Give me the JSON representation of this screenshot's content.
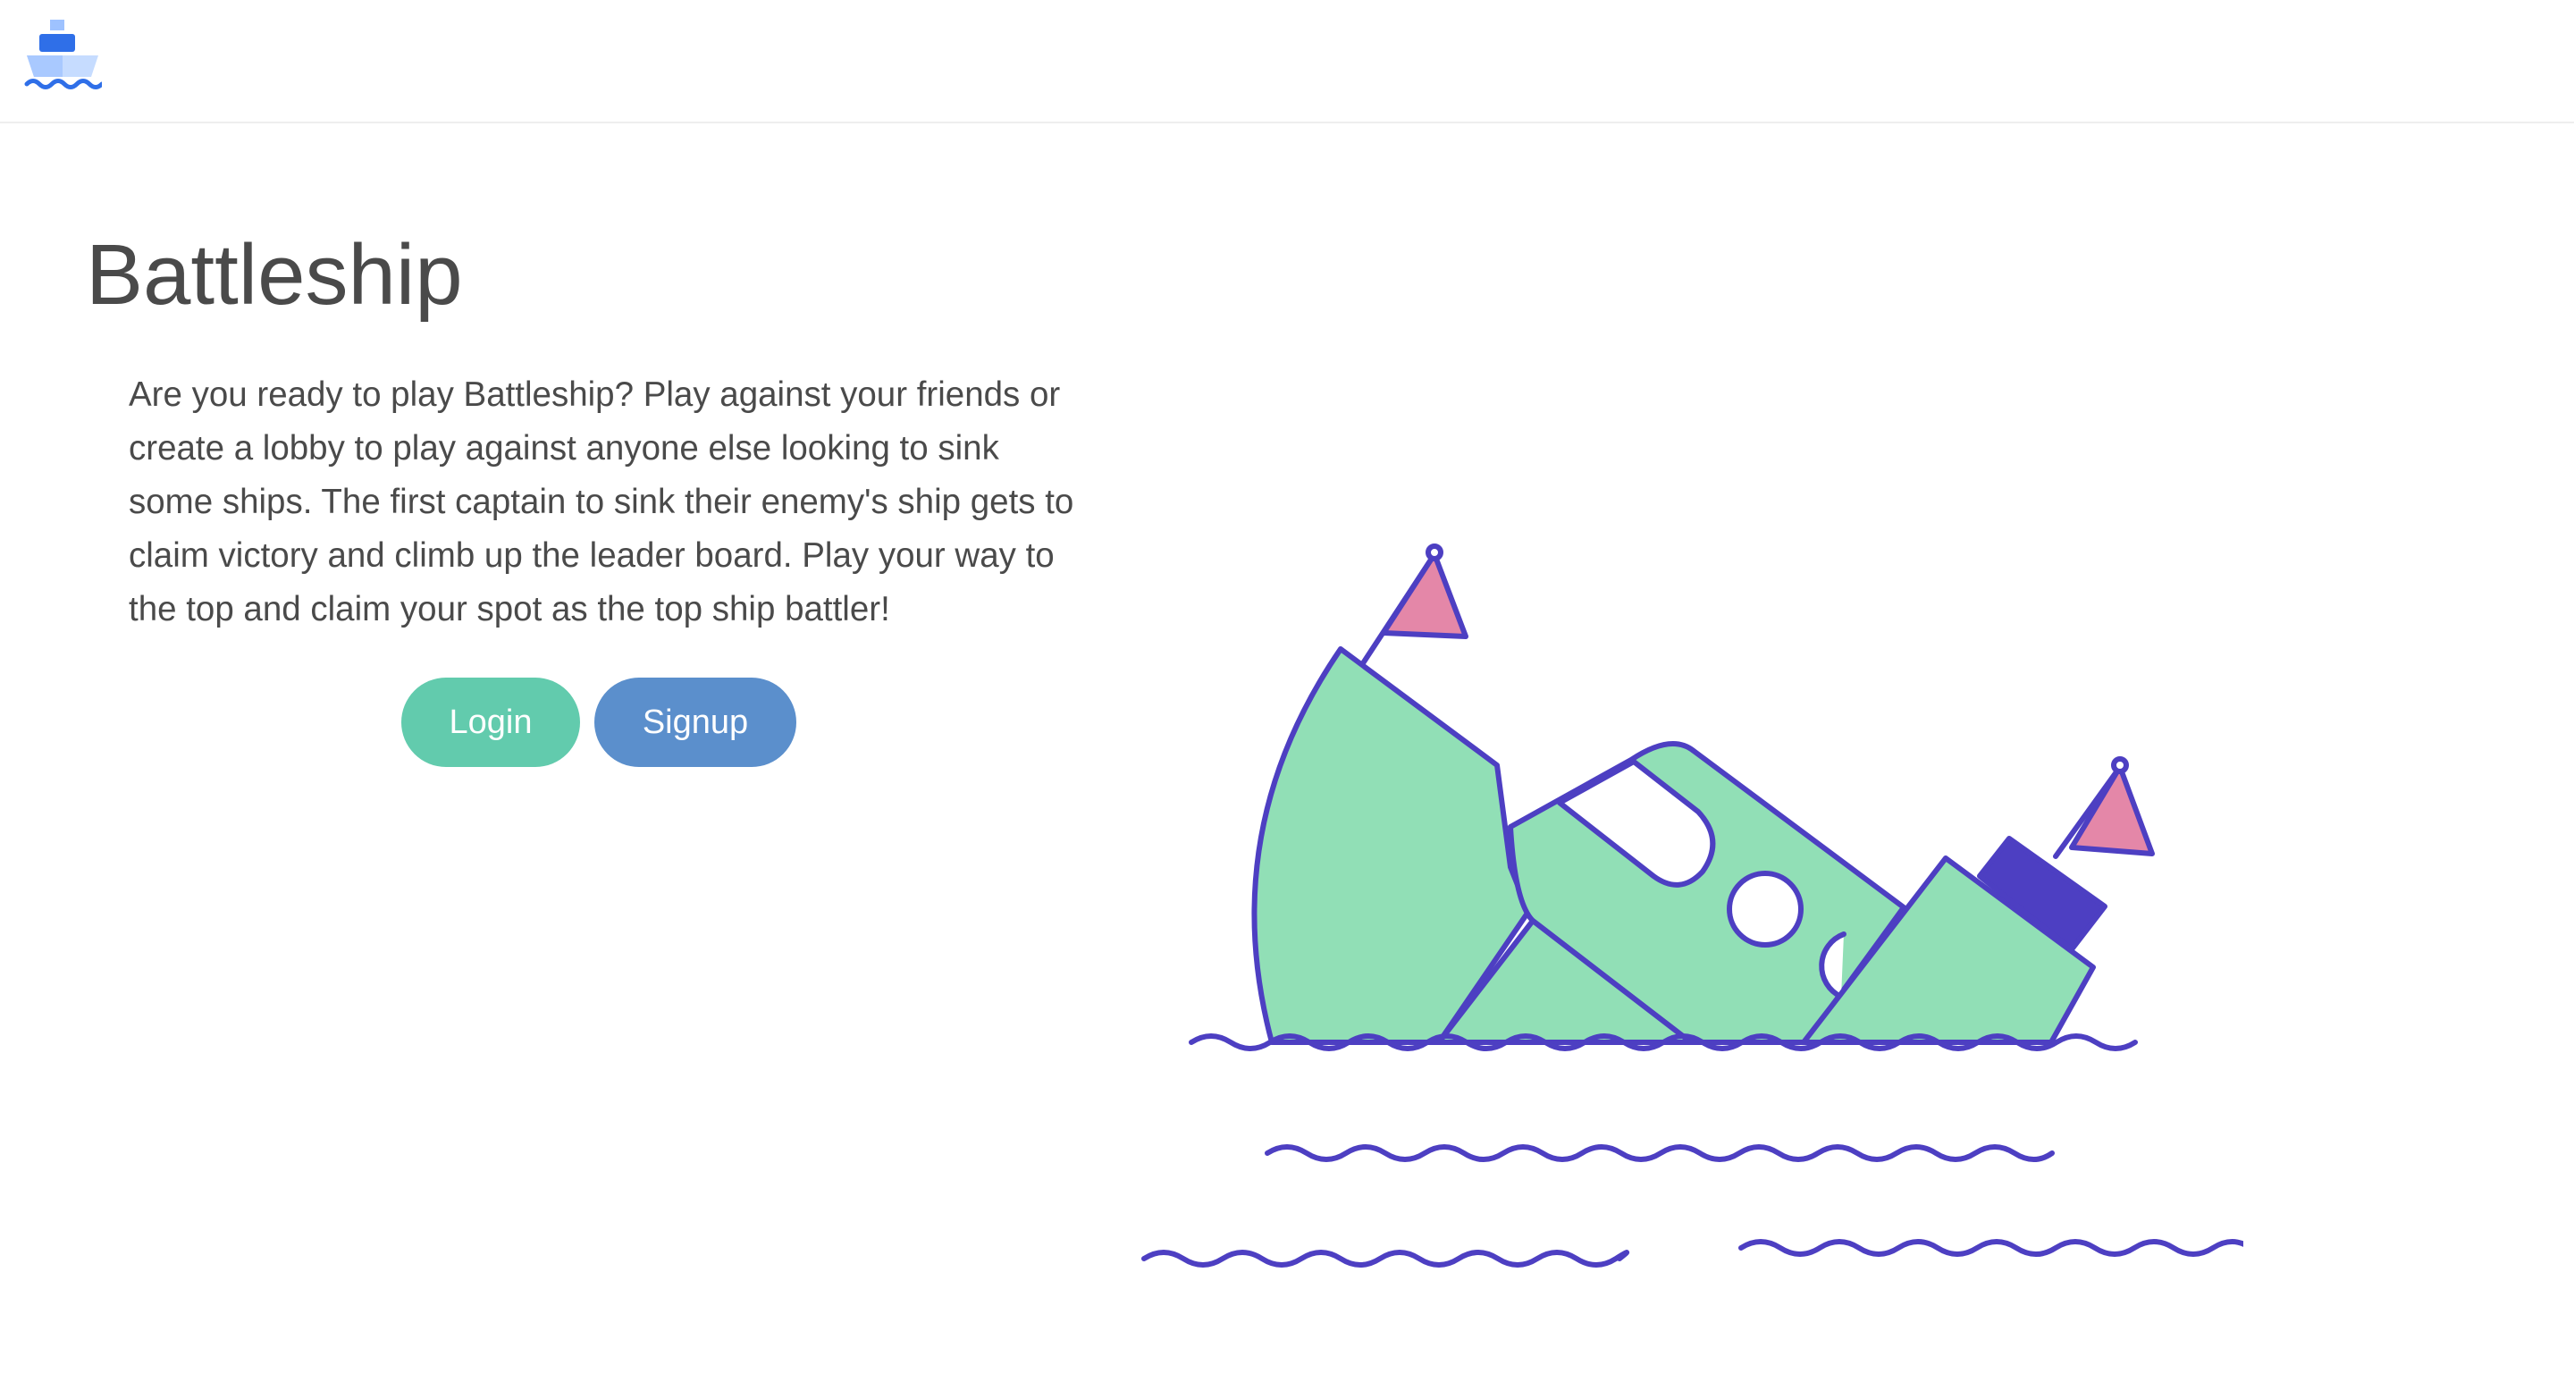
{
  "navbar": {
    "logo_icon": "ship-logo-icon"
  },
  "hero": {
    "title": "Battleship",
    "description": "Are you ready to play Battleship? Play against your friends or create a lobby to play against anyone else looking to sink some ships. The first captain to sink their enemy's ship gets to claim victory and climb up the leader board. Play your way to the top and claim your spot as the top ship battler!",
    "login_label": "Login",
    "signup_label": "Signup",
    "illustration_icon": "sinking-ship-illustration"
  },
  "colors": {
    "login_button": "#62cbad",
    "signup_button": "#5b8fcc",
    "ship_hull": "#91dfb6",
    "outline": "#4d3fc2",
    "flag": "#e487a8",
    "logo_blue": "#2f6fe8"
  }
}
